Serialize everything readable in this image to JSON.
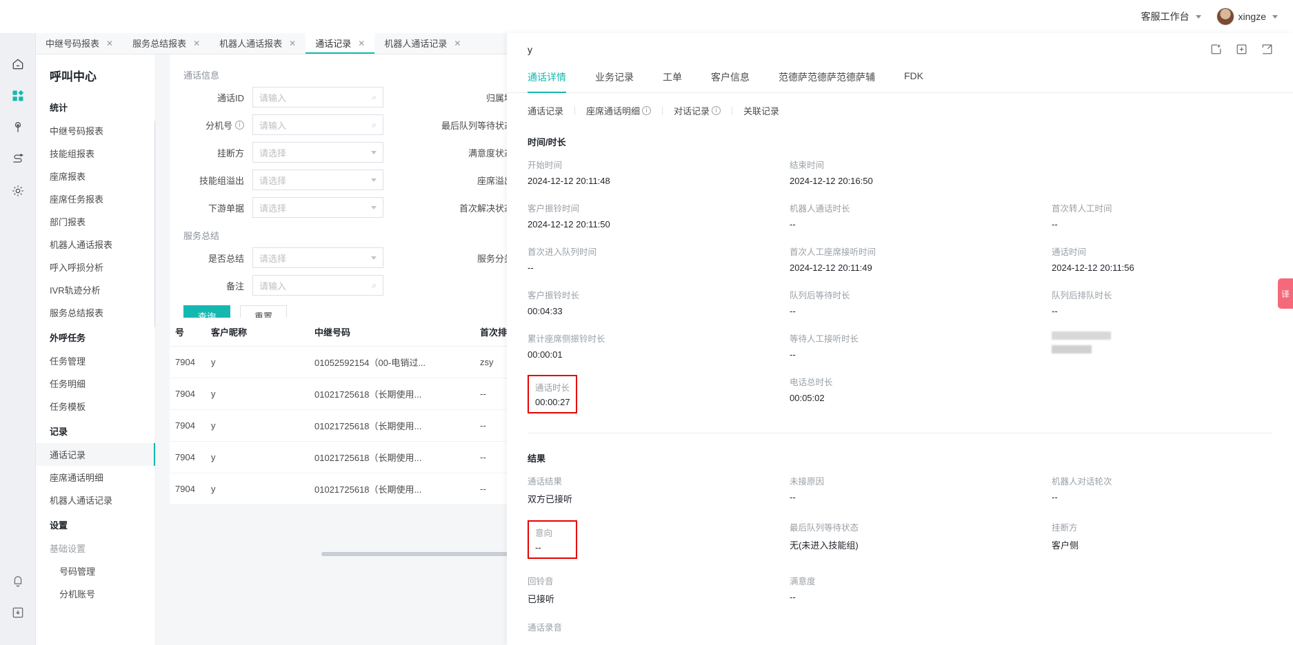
{
  "topbar": {
    "workbench_label": "客服工作台",
    "user_name": "xingze"
  },
  "rail": {
    "icons": [
      "home-icon",
      "apps-icon",
      "user-icon",
      "flow-icon",
      "gear-icon",
      "bell-icon",
      "download-icon"
    ]
  },
  "tabs": [
    {
      "label": "中继号码报表",
      "active": false
    },
    {
      "label": "服务总结报表",
      "active": false
    },
    {
      "label": "机器人通话报表",
      "active": false
    },
    {
      "label": "通话记录",
      "active": true
    },
    {
      "label": "机器人通话记录",
      "active": false
    }
  ],
  "nav": {
    "title": "呼叫中心",
    "groups": [
      {
        "label": "统计",
        "items": [
          {
            "label": "中继号码报表",
            "active": false
          },
          {
            "label": "技能组报表",
            "active": false
          },
          {
            "label": "座席报表",
            "active": false
          },
          {
            "label": "座席任务报表",
            "active": false
          },
          {
            "label": "部门报表",
            "active": false
          },
          {
            "label": "机器人通话报表",
            "active": false
          },
          {
            "label": "呼入呼损分析",
            "active": false
          },
          {
            "label": "IVR轨迹分析",
            "active": false
          },
          {
            "label": "服务总结报表",
            "active": false
          }
        ]
      },
      {
        "label": "外呼任务",
        "items": [
          {
            "label": "任务管理",
            "active": false
          },
          {
            "label": "任务明细",
            "active": false
          },
          {
            "label": "任务模板",
            "active": false
          }
        ]
      },
      {
        "label": "记录",
        "items": [
          {
            "label": "通话记录",
            "active": true
          },
          {
            "label": "座席通话明细",
            "active": false
          },
          {
            "label": "机器人通话记录",
            "active": false
          }
        ]
      },
      {
        "label": "设置",
        "items": [
          {
            "label": "基础设置",
            "muted": true
          },
          {
            "label": "号码管理",
            "sub": true
          },
          {
            "label": "分机账号",
            "sub": true
          }
        ]
      }
    ]
  },
  "filters": {
    "section_call_info": "通话信息",
    "section_service_summary": "服务总结",
    "placeholder_input": "请输入",
    "placeholder_select": "请选择",
    "rows": [
      {
        "left_label": "通话ID",
        "left_type": "input",
        "right_label": "归属地",
        "right_type": "select"
      },
      {
        "left_label": "分机号",
        "left_type": "input",
        "left_info": true,
        "right_label": "最后队列等待状态",
        "right_type": "select"
      },
      {
        "left_label": "挂断方",
        "left_type": "select",
        "right_label": "满意度状态",
        "right_type": "select"
      },
      {
        "left_label": "技能组溢出",
        "left_type": "select",
        "right_label": "座席溢出",
        "right_type": "select"
      },
      {
        "left_label": "下游单据",
        "left_type": "select",
        "right_label": "首次解决状态",
        "right_type": "select"
      }
    ],
    "summary_rows": [
      {
        "left_label": "是否总结",
        "left_type": "select",
        "right_label": "服务分类",
        "right_type": "select"
      },
      {
        "left_label": "备注",
        "left_type": "input",
        "right_label": "",
        "right_type": ""
      }
    ],
    "search_button": "查询",
    "reset_button": "重置"
  },
  "table": {
    "headers": [
      "号",
      "客户昵称",
      "中继号码",
      "首次排队技能组"
    ],
    "rows": [
      {
        "id": "7904",
        "nickname": "y",
        "trunk": "01052592154（00-电销过...",
        "skill": "zsy"
      },
      {
        "id": "7904",
        "nickname": "y",
        "trunk": "01021725618（长期使用...",
        "skill": "--"
      },
      {
        "id": "7904",
        "nickname": "y",
        "trunk": "01021725618（长期使用...",
        "skill": "--"
      },
      {
        "id": "7904",
        "nickname": "y",
        "trunk": "01021725618（长期使用...",
        "skill": "--"
      },
      {
        "id": "7904",
        "nickname": "y",
        "trunk": "01021725618（长期使用...",
        "skill": "--"
      }
    ]
  },
  "drawer": {
    "title": "y",
    "close_icon": "close-icon",
    "action_icons": [
      "add-note-icon",
      "add-task-icon",
      "expand-icon"
    ],
    "tabs": [
      {
        "label": "通话详情",
        "active": true
      },
      {
        "label": "业务记录",
        "active": false
      },
      {
        "label": "工单",
        "active": false
      },
      {
        "label": "客户信息",
        "active": false
      },
      {
        "label": "范德萨范德萨范德萨辅",
        "active": false
      },
      {
        "label": "FDK",
        "active": false
      }
    ],
    "subtabs": [
      {
        "label": "通话记录",
        "info": false
      },
      {
        "label": "座席通话明细",
        "info": true
      },
      {
        "label": "对话记录",
        "info": true
      },
      {
        "label": "关联记录",
        "info": false
      }
    ],
    "time_section": {
      "title": "时间/时长",
      "cells": [
        {
          "label": "开始时间",
          "value": "2024-12-12 20:11:48"
        },
        {
          "label": "结束时间",
          "value": "2024-12-12 20:16:50"
        },
        {
          "label": "",
          "value": ""
        },
        {
          "label": "客户振铃时间",
          "value": "2024-12-12 20:11:50"
        },
        {
          "label": "机器人通话时长",
          "value": "--"
        },
        {
          "label": "首次转人工时间",
          "value": "--"
        },
        {
          "label": "首次进入队列时间",
          "value": "--"
        },
        {
          "label": "首次人工座席接听时间",
          "value": "2024-12-12 20:11:49"
        },
        {
          "label": "通话时间",
          "value": "2024-12-12 20:11:56"
        },
        {
          "label": "客户振铃时长",
          "value": "00:04:33"
        },
        {
          "label": "队列后等待时长",
          "value": "--"
        },
        {
          "label": "队列后排队时长",
          "value": "--"
        },
        {
          "label": "累计座席侧振铃时长",
          "value": "00:00:01"
        },
        {
          "label": "等待人工接听时长",
          "value": "--"
        },
        {
          "label": "REDACTED",
          "value": "REDACTED"
        },
        {
          "label": "通话时长",
          "value": "00:00:27",
          "highlight": true
        },
        {
          "label": "电话总时长",
          "value": "00:05:02"
        },
        {
          "label": "",
          "value": ""
        }
      ]
    },
    "result_section": {
      "title": "结果",
      "cells": [
        {
          "label": "通话结果",
          "value": "双方已接听"
        },
        {
          "label": "未接原因",
          "value": "--"
        },
        {
          "label": "机器人对话轮次",
          "value": "--"
        },
        {
          "label": "意向",
          "value": "--",
          "highlight": true
        },
        {
          "label": "最后队列等待状态",
          "value": "无(未进入技能组)"
        },
        {
          "label": "挂断方",
          "value": "客户侧"
        },
        {
          "label": "回铃音",
          "value": "已接听"
        },
        {
          "label": "满意度",
          "value": "--"
        },
        {
          "label": "",
          "value": ""
        }
      ]
    },
    "next_section_title": "通话录音"
  },
  "fab": {
    "label": "译",
    "color": "#f5697a"
  },
  "colors": {
    "accent": "#14b8b0",
    "highlight": "#e60000"
  }
}
